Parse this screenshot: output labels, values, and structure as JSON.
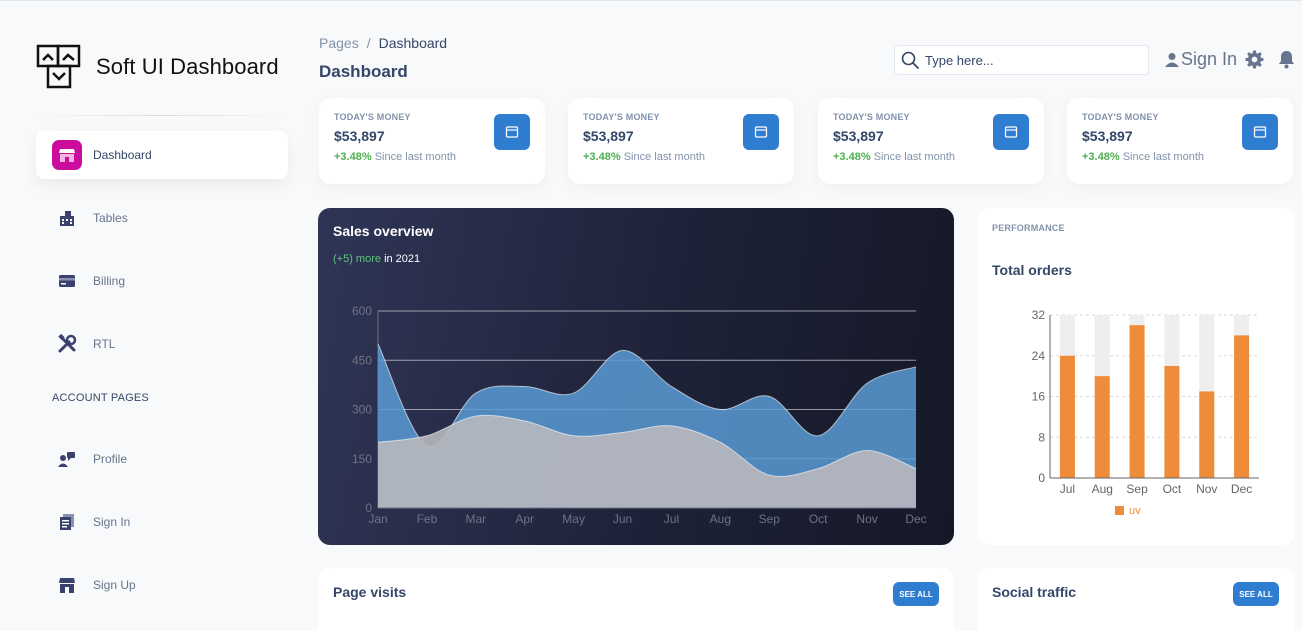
{
  "brand": {
    "name": "Soft UI Dashboard"
  },
  "sidebar": {
    "items": [
      {
        "label": "Dashboard",
        "icon": "shop-icon"
      },
      {
        "label": "Tables",
        "icon": "office-icon"
      },
      {
        "label": "Billing",
        "icon": "credit-card-icon"
      },
      {
        "label": "RTL",
        "icon": "tools-icon"
      },
      {
        "label": "Profile",
        "icon": "customer-support-icon"
      },
      {
        "label": "Sign In",
        "icon": "document-icon"
      },
      {
        "label": "Sign Up",
        "icon": "shop-icon"
      }
    ],
    "section_title": "ACCOUNT PAGES",
    "active_color": "#cb0c9f"
  },
  "header": {
    "breadcrumb": {
      "parent": "Pages",
      "separator": "/",
      "current": "Dashboard"
    },
    "title": "Dashboard",
    "search_placeholder": "Type here...",
    "signin_label": "Sign In"
  },
  "stats": [
    {
      "label": "TODAY'S MONEY",
      "value": "$53,897",
      "change": "+3.48%",
      "note": "Since last month"
    },
    {
      "label": "TODAY'S MONEY",
      "value": "$53,897",
      "change": "+3.48%",
      "note": "Since last month"
    },
    {
      "label": "TODAY'S MONEY",
      "value": "$53,897",
      "change": "+3.48%",
      "note": "Since last month"
    },
    {
      "label": "TODAY'S MONEY",
      "value": "$53,897",
      "change": "+3.48%",
      "note": "Since last month"
    }
  ],
  "sales": {
    "title": "Sales overview",
    "subtitle_highlight": "(+5) more",
    "subtitle_rest": "in 2021"
  },
  "orders": {
    "label": "PERFORMANCE",
    "title": "Total orders"
  },
  "bottom": {
    "page_visits_title": "Page visits",
    "social_traffic_title": "Social traffic",
    "see_all_label": "SEE ALL"
  },
  "chart_data": [
    {
      "type": "area",
      "categories": [
        "Jan",
        "Feb",
        "Mar",
        "Apr",
        "May",
        "Jun",
        "Jul",
        "Aug",
        "Sep",
        "Oct",
        "Nov",
        "Dec"
      ],
      "yticks": [
        0,
        150,
        300,
        450,
        600
      ],
      "ylim": [
        0,
        600
      ],
      "series": [
        {
          "values": [
            500,
            190,
            350,
            370,
            350,
            480,
            370,
            300,
            340,
            220,
            380,
            430
          ],
          "color": "#5b9bd5"
        },
        {
          "values": [
            200,
            220,
            280,
            265,
            220,
            230,
            250,
            200,
            100,
            120,
            175,
            120
          ],
          "color": "#b8b8be"
        }
      ],
      "grid": true
    },
    {
      "type": "bar",
      "categories": [
        "Jul",
        "Aug",
        "Sep",
        "Oct",
        "Nov",
        "Dec"
      ],
      "yticks": [
        0,
        8,
        16,
        24,
        32
      ],
      "ylim": [
        0,
        32
      ],
      "series": [
        {
          "name": "uv",
          "values": [
            24,
            20,
            30,
            22,
            17,
            28
          ],
          "color": "#ee8c3a"
        }
      ],
      "background_bars": true,
      "legend": "bottom"
    }
  ]
}
